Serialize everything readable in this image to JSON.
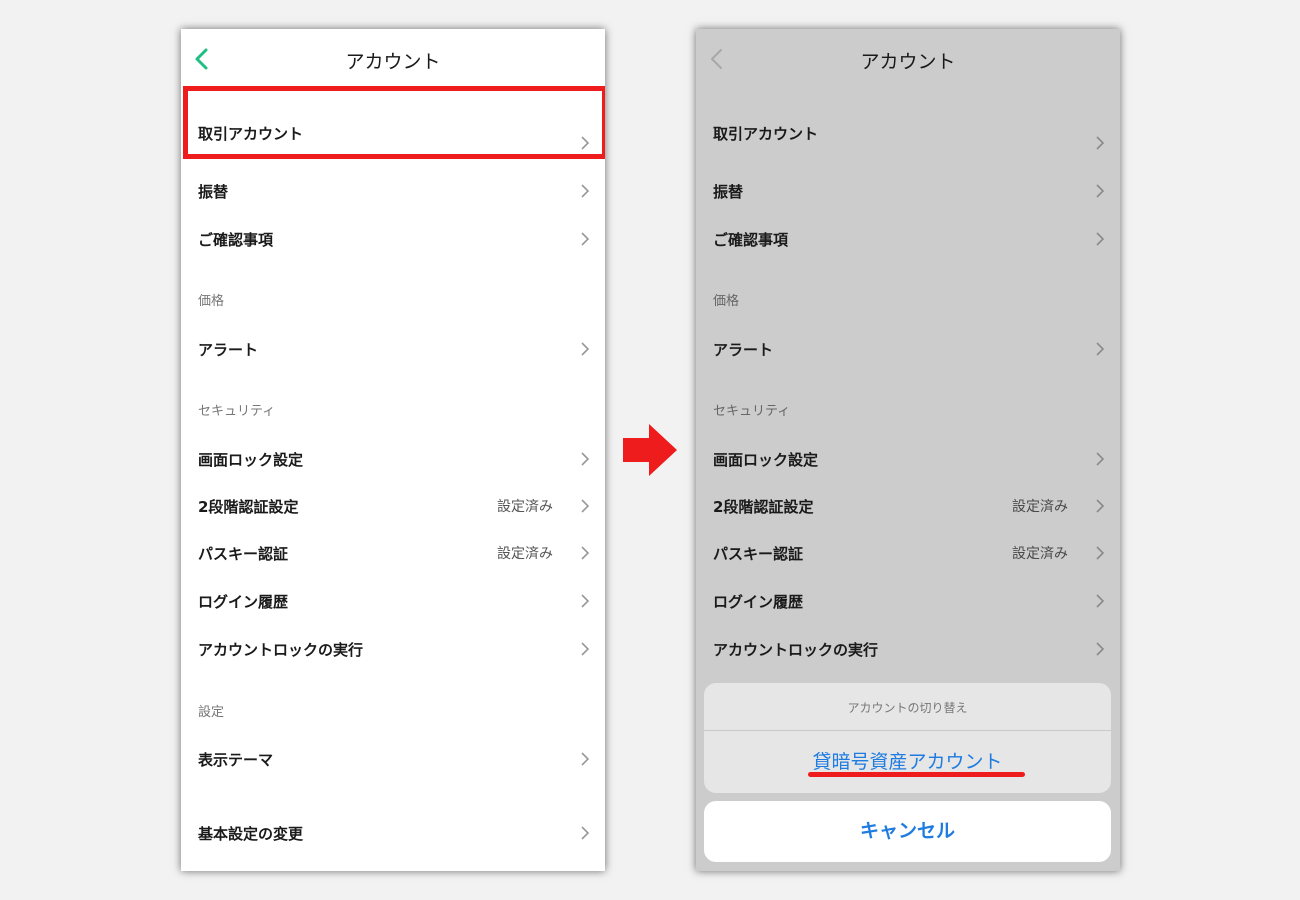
{
  "colors": {
    "accent_green": "#1fbf84",
    "highlight_red": "#ee1c1c",
    "link_blue": "#1e7be0",
    "dim_overlay": "#cccccc"
  },
  "left_screen": {
    "nav": {
      "title": "アカウント",
      "back_icon": "chevron-left-icon"
    },
    "items": {
      "trading_account": "取引アカウント",
      "transfer": "振替",
      "confirmation": "ご確認事項",
      "alert": "アラート",
      "screen_lock": "画面ロック設定",
      "two_factor": "2段階認証設定",
      "two_factor_value": "設定済み",
      "passkey": "パスキー認証",
      "passkey_value": "設定済み",
      "login_history": "ログイン履歴",
      "account_lock": "アカウントロックの実行",
      "display_theme": "表示テーマ",
      "basic_settings": "基本設定の変更"
    },
    "sections": {
      "price": "価格",
      "security": "セキュリティ",
      "settings": "設定"
    }
  },
  "right_screen": {
    "nav": {
      "title": "アカウント",
      "back_icon": "chevron-left-icon"
    },
    "items": {
      "trading_account": "取引アカウント",
      "transfer": "振替",
      "confirmation": "ご確認事項",
      "alert": "アラート",
      "screen_lock": "画面ロック設定",
      "two_factor": "2段階認証設定",
      "two_factor_value": "設定済み",
      "passkey": "パスキー認証",
      "passkey_value": "設定済み",
      "login_history": "ログイン履歴",
      "account_lock": "アカウントロックの実行"
    },
    "sections": {
      "price": "価格",
      "security": "セキュリティ"
    },
    "action_sheet": {
      "title": "アカウントの切り替え",
      "option": "貸暗号資産アカウント",
      "cancel": "キャンセル"
    }
  },
  "transition_icon": "right-arrow-icon"
}
